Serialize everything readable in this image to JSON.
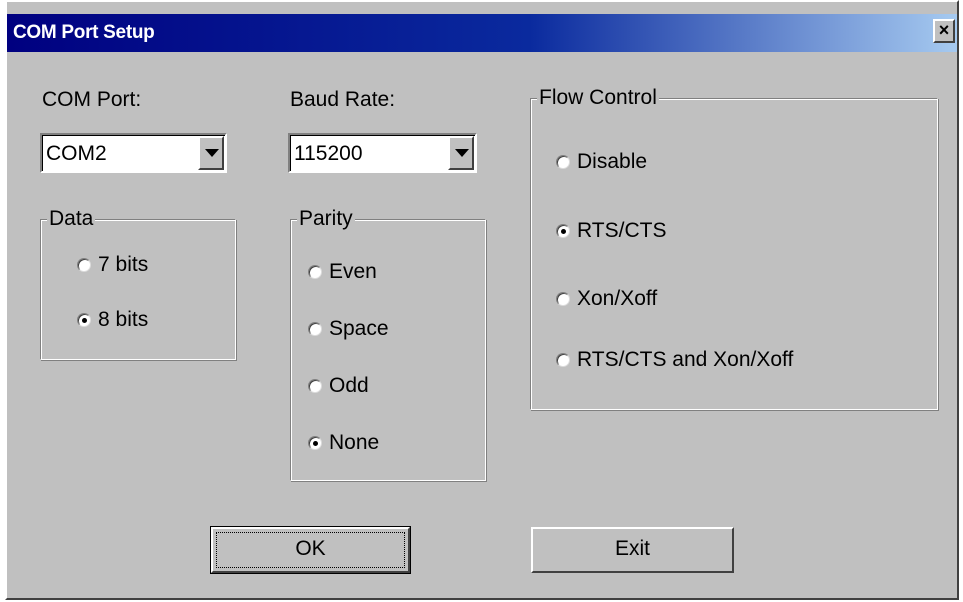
{
  "window": {
    "title": "COM Port Setup",
    "close_glyph": "×",
    "close_icon": "close-icon"
  },
  "com_port": {
    "label": "COM Port:",
    "value": "COM2"
  },
  "baud_rate": {
    "label": "Baud Rate:",
    "value": "115200"
  },
  "data_group": {
    "title": "Data",
    "options": [
      {
        "label": "7 bits",
        "checked": false
      },
      {
        "label": "8 bits",
        "checked": true
      }
    ]
  },
  "parity_group": {
    "title": "Parity",
    "options": [
      {
        "label": "Even",
        "checked": false
      },
      {
        "label": "Space",
        "checked": false
      },
      {
        "label": "Odd",
        "checked": false
      },
      {
        "label": "None",
        "checked": true
      }
    ]
  },
  "flow_group": {
    "title": "Flow Control",
    "options": [
      {
        "label": "Disable",
        "checked": false
      },
      {
        "label": "RTS/CTS",
        "checked": true
      },
      {
        "label": "Xon/Xoff",
        "checked": false
      },
      {
        "label": "RTS/CTS and Xon/Xoff",
        "checked": false
      }
    ]
  },
  "buttons": {
    "ok": "OK",
    "exit": "Exit"
  },
  "colors": {
    "face": "#c0c0c0",
    "title_start": "#000080",
    "title_end": "#a6caf0"
  }
}
